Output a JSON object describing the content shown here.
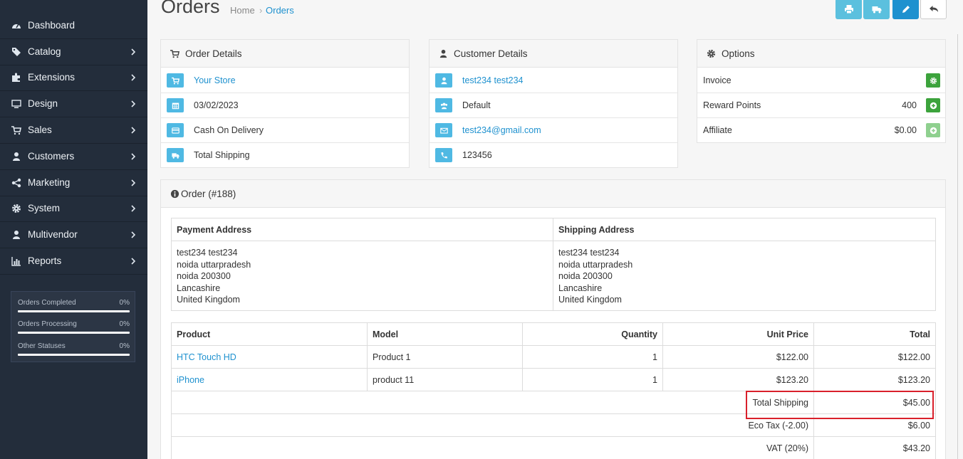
{
  "sidebar": {
    "items": [
      {
        "label": "Dashboard",
        "icon": "dashboard-icon",
        "chevron": false
      },
      {
        "label": "Catalog",
        "icon": "tags-icon",
        "chevron": true
      },
      {
        "label": "Extensions",
        "icon": "puzzle-icon",
        "chevron": true
      },
      {
        "label": "Design",
        "icon": "monitor-icon",
        "chevron": true
      },
      {
        "label": "Sales",
        "icon": "cart-icon",
        "chevron": true
      },
      {
        "label": "Customers",
        "icon": "user-icon",
        "chevron": true
      },
      {
        "label": "Marketing",
        "icon": "share-icon",
        "chevron": true
      },
      {
        "label": "System",
        "icon": "gear-icon",
        "chevron": true
      },
      {
        "label": "Multivendor",
        "icon": "user-icon",
        "chevron": true
      },
      {
        "label": "Reports",
        "icon": "bar-chart-icon",
        "chevron": true
      }
    ],
    "stats": [
      {
        "label": "Orders Completed",
        "value": "0%"
      },
      {
        "label": "Orders Processing",
        "value": "0%"
      },
      {
        "label": "Other Statuses",
        "value": "0%"
      }
    ]
  },
  "header": {
    "title": "Orders",
    "breadcrumb_home": "Home",
    "breadcrumb_sep": "›",
    "breadcrumb_current": "Orders"
  },
  "order_details": {
    "title": "Order Details",
    "store": "Your Store",
    "date": "03/02/2023",
    "payment": "Cash On Delivery",
    "shipping": "Total Shipping"
  },
  "customer_details": {
    "title": "Customer Details",
    "name": "test234 test234",
    "group": "Default",
    "email": "test234@gmail.com",
    "phone": "123456"
  },
  "options": {
    "title": "Options",
    "invoice_label": "Invoice",
    "reward_label": "Reward Points",
    "reward_value": "400",
    "affiliate_label": "Affiliate",
    "affiliate_value": "$0.00"
  },
  "order": {
    "title": "Order (#188)",
    "payment_address_header": "Payment Address",
    "shipping_address_header": "Shipping Address",
    "payment_address": [
      "test234 test234",
      "noida uttarpradesh",
      "noida 200300",
      "Lancashire",
      "United Kingdom"
    ],
    "shipping_address": [
      "test234 test234",
      "noida uttarpradesh",
      "noida 200300",
      "Lancashire",
      "United Kingdom"
    ],
    "columns": {
      "product": "Product",
      "model": "Model",
      "quantity": "Quantity",
      "unit_price": "Unit Price",
      "total": "Total"
    },
    "products": [
      {
        "name": "HTC Touch HD",
        "model": "Product 1",
        "quantity": "1",
        "unit_price": "$122.00",
        "total": "$122.00"
      },
      {
        "name": "iPhone",
        "model": "product 11",
        "quantity": "1",
        "unit_price": "$123.20",
        "total": "$123.20"
      }
    ],
    "totals": [
      {
        "label": "Total Shipping",
        "value": "$45.00"
      },
      {
        "label": "Eco Tax (-2.00)",
        "value": "$6.00"
      },
      {
        "label": "VAT (20%)",
        "value": "$43.20"
      }
    ]
  },
  "colors": {
    "sidebar_bg": "#232d3b",
    "accent": "#1e91cf",
    "info_button": "#5bc0de",
    "success": "#3ca33c",
    "highlight": "#d9202b"
  }
}
